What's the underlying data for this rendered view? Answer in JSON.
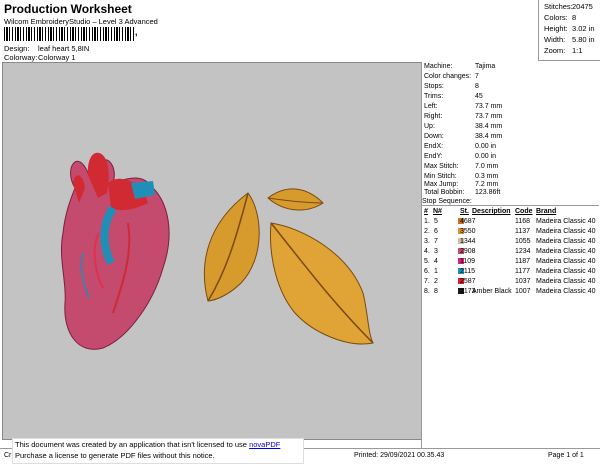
{
  "header": {
    "title": "Production Worksheet",
    "subtitle": "Wilcom EmbroideryStudio – Level 3 Advanced",
    "barcode_tail": ",",
    "design_label": "Design:",
    "design_value": "leaf heart 5,8IN",
    "colorway_label": "Colorway:",
    "colorway_value": "Colorway 1"
  },
  "stats": [
    {
      "label": "Stitches:",
      "value": "20475"
    },
    {
      "label": "Colors:",
      "value": "8"
    },
    {
      "label": "Height:",
      "value": "3.02 in"
    },
    {
      "label": "Width:",
      "value": "5.80 in"
    },
    {
      "label": "Zoom:",
      "value": "1:1"
    }
  ],
  "info": [
    {
      "label": "Machine:",
      "value": "Tajima"
    },
    {
      "label": "Color changes:",
      "value": "7"
    },
    {
      "label": "Stops:",
      "value": "8"
    },
    {
      "label": "Trims:",
      "value": "45"
    },
    {
      "label": "Left:",
      "value": "73.7 mm"
    },
    {
      "label": "Right:",
      "value": "73.7 mm"
    },
    {
      "label": "Up:",
      "value": "38.4 mm"
    },
    {
      "label": "Down:",
      "value": "38.4 mm"
    },
    {
      "label": "EndX:",
      "value": "0.00 in"
    },
    {
      "label": "EndY:",
      "value": "0.00 in"
    },
    {
      "label": "Max Stitch:",
      "value": "7.0 mm"
    },
    {
      "label": "Min Stitch:",
      "value": "0.3 mm"
    },
    {
      "label": "Max Jump:",
      "value": "7.2 mm"
    },
    {
      "label": "Total Bobbin:",
      "value": "123.86ft"
    }
  ],
  "sequence": {
    "heading": "Stop Sequence:",
    "columns": [
      "#",
      "N#",
      "St.",
      "Description",
      "Code",
      "Brand"
    ],
    "rows": [
      {
        "num": "1.",
        "n": "5",
        "color": "#c0741f",
        "st": "4687",
        "desc": "",
        "code": "1168",
        "brand": "Madeira Classic 40"
      },
      {
        "num": "2.",
        "n": "6",
        "color": "#e2932e",
        "st": "3550",
        "desc": "",
        "code": "1137",
        "brand": "Madeira Classic 40"
      },
      {
        "num": "3.",
        "n": "7",
        "color": "#c9c0a4",
        "st": "1344",
        "desc": "",
        "code": "1055",
        "brand": "Madeira Classic 40"
      },
      {
        "num": "4.",
        "n": "3",
        "color": "#c0506e",
        "st": "2908",
        "desc": "",
        "code": "1234",
        "brand": "Madeira Classic 40"
      },
      {
        "num": "5.",
        "n": "4",
        "color": "#d1217a",
        "st": "1109",
        "desc": "",
        "code": "1187",
        "brand": "Madeira Classic 40"
      },
      {
        "num": "6.",
        "n": "1",
        "color": "#1f8fb8",
        "st": "2115",
        "desc": "",
        "code": "1177",
        "brand": "Madeira Classic 40"
      },
      {
        "num": "7.",
        "n": "2",
        "color": "#d1202e",
        "st": "2587",
        "desc": "",
        "code": "1037",
        "brand": "Madeira Classic 40"
      },
      {
        "num": "8.",
        "n": "8",
        "color": "#1a1a1a",
        "st": "2173",
        "desc": "Amber Black",
        "code": "1007",
        "brand": "Madeira Classic 40"
      }
    ]
  },
  "footer": {
    "notice_line1": "This document was created by an application that isn't licensed to use ",
    "notice_link": "novaPDF",
    "notice_line2": "Purchase a license to generate PDF files without this notice.",
    "cr": "Cr",
    "printed": "Printed: 29/09/2021 00.35.43",
    "page": "Page 1 of 1"
  }
}
